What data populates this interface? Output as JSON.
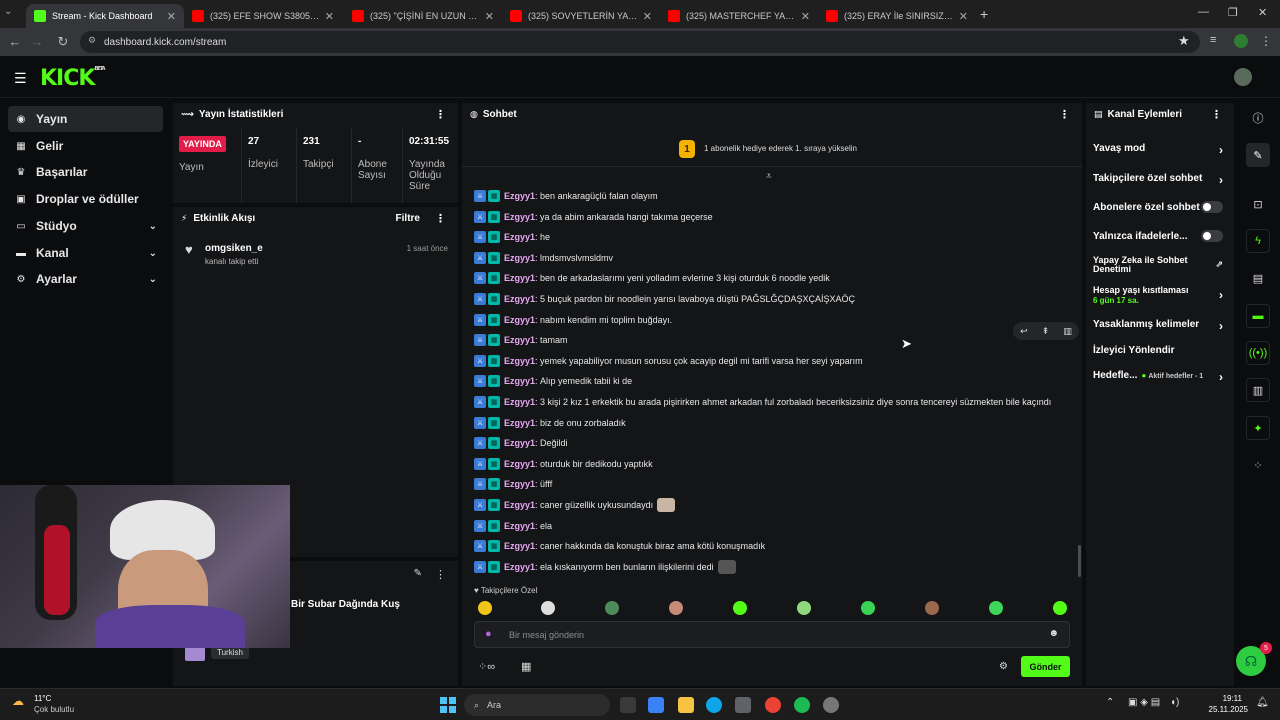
{
  "browser": {
    "tabs": [
      {
        "label": "Stream - Kick Dashboard",
        "active": true
      },
      {
        "label": "(325) EFE SHOW S3805 | ATİZ4..."
      },
      {
        "label": "(325) \"ÇİŞİNİ EN UZUN SÜRE TU..."
      },
      {
        "label": "(325) SOVYETLERİN YARATTIĞI..."
      },
      {
        "label": "(325) MASTERCHEF YARIŞMACI..."
      },
      {
        "label": "(325) ERAY İle SINIRSIZ YEMEK..."
      }
    ],
    "url": "dashboard.kick.com/stream"
  },
  "app": {
    "logo": "KICK",
    "logo_sup": "BETA"
  },
  "sidebar": {
    "items": [
      {
        "label": "Yayın",
        "icon": "dot-icon"
      },
      {
        "label": "Gelir",
        "icon": "money-icon"
      },
      {
        "label": "Başarılar",
        "icon": "trophy-icon"
      },
      {
        "label": "Droplar ve ödüller",
        "icon": "gift-icon"
      },
      {
        "label": "Stüdyo",
        "icon": "studio-icon"
      },
      {
        "label": "Kanal",
        "icon": "user-icon"
      },
      {
        "label": "Ayarlar",
        "icon": "gear-icon"
      }
    ]
  },
  "stats": {
    "title": "Yayın İstatistikleri",
    "live_badge": "YAYINDA",
    "cols": [
      {
        "value": "",
        "label": "Yayın"
      },
      {
        "value": "27",
        "label": "İzleyici"
      },
      {
        "value": "231",
        "label": "Takipçi"
      },
      {
        "value": "-",
        "label": "Abone Sayısı"
      },
      {
        "value": "02:31:55",
        "label": "Yayında Olduğu Süre"
      }
    ]
  },
  "activity": {
    "title": "Etkinlik Akışı",
    "filter": "Filtre",
    "events": [
      {
        "user": "omgsiken_e",
        "text": "kanalı takip etti",
        "time": "1 saat önce"
      }
    ]
  },
  "player": {
    "title": "Bir Subar Dağında Kuş",
    "language": "Turkish"
  },
  "chat": {
    "title": "Sohbet",
    "sub_goal": "1 abonelik hediye ederek 1. sıraya yükselin",
    "sub_rank": "1",
    "messages": [
      {
        "user": "Ezgyy1",
        "text": "ben ankaragüçlü falan olayım"
      },
      {
        "user": "Ezgyy1",
        "text": "ya da abim ankarada hangi takıma geçerse"
      },
      {
        "user": "Ezgyy1",
        "text": "he"
      },
      {
        "user": "Ezgyy1",
        "text": "lmdsmvslvmsldmv"
      },
      {
        "user": "Ezgyy1",
        "text": "ben de arkadaslarımı yeni yolladım evlerine 3 kişi oturduk 6 noodle yedik"
      },
      {
        "user": "Ezgyy1",
        "text": "5 buçuk pardon bir noodlein yarısı lavaboya düştü PAĞSLĞÇDAŞXÇAİŞXAÖÇ"
      },
      {
        "user": "Ezgyy1",
        "text": "nabım kendim mi toplim buğdayı."
      },
      {
        "user": "Ezgyy1",
        "text": "tamam"
      },
      {
        "user": "Ezgyy1",
        "text": "yemek yapabiliyor musun sorusu çok acayip degil mi tarifi varsa her seyi yaparım"
      },
      {
        "user": "Ezgyy1",
        "text": "Alıp yemedik tabii ki de"
      },
      {
        "user": "Ezgyy1",
        "text": "3 kişi 2 kız 1 erkektik bu arada pişirirken ahmet arkadan ful zorbaladı beceriksizsiniz diye sonra tencereyi süzmekten bile kaçındı"
      },
      {
        "user": "Ezgyy1",
        "text": "biz de onu zorbaladık"
      },
      {
        "user": "Ezgyy1",
        "text": "Değildi"
      },
      {
        "user": "Ezgyy1",
        "text": "oturduk bir dedikodu yaptıkk"
      },
      {
        "user": "Ezgyy1",
        "text": "üfff"
      },
      {
        "user": "Ezgyy1",
        "text": "caner güzellik uykusundaydı"
      },
      {
        "user": "Ezgyy1",
        "text": "ela"
      },
      {
        "user": "Ezgyy1",
        "text": "caner hakkında da konuştuk biraz ama kötü konuşmadık"
      },
      {
        "user": "Ezgyy1",
        "text": "ela kıskanıyorm ben bunların ilişkilerini dedi"
      }
    ],
    "followers_only": "Takipçilere Özel",
    "input_placeholder": "Bir mesaj gönderin",
    "send": "Gönder"
  },
  "actions": {
    "title": "Kanal Eylemleri",
    "items": [
      {
        "label": "Yavaş mod",
        "kind": "arrow"
      },
      {
        "label": "Takipçilere özel sohbet",
        "kind": "arrow"
      },
      {
        "label": "Abonelere özel sohbet",
        "kind": "toggle"
      },
      {
        "label": "Yalnızca ifadelerle...",
        "kind": "toggle"
      },
      {
        "label": "Yapay Zeka ile Sohbet Denetimi",
        "kind": "external"
      },
      {
        "label": "Hesap yaşı kısıtlaması",
        "sub": "6 gün 17 sa.",
        "kind": "arrow"
      },
      {
        "label": "Yasaklanmış kelimeler",
        "kind": "arrow"
      },
      {
        "label": "İzleyici Yönlendir",
        "kind": "none"
      },
      {
        "label": "Hedefle...",
        "sub": "Aktif hedefler - 1",
        "kind": "arrow"
      }
    ]
  },
  "taskbar": {
    "weather_temp": "11°C",
    "weather_text": "Çok bulutlu",
    "search": "Ara",
    "time": "19:11",
    "date": "25.11.2025"
  },
  "notification_count": "5",
  "colors": {
    "brand": "#53fc18",
    "live": "#e11d48",
    "panel": "#141517"
  }
}
